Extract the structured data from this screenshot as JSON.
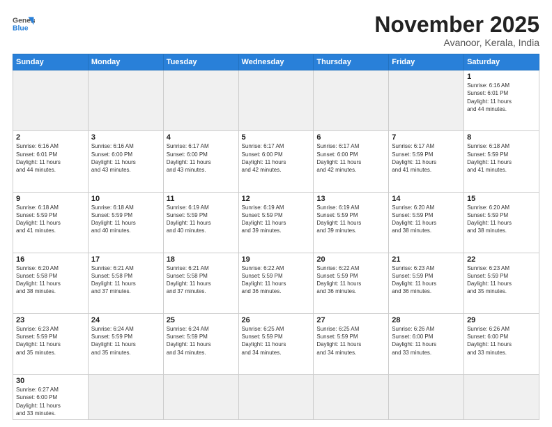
{
  "logo": {
    "line1": "General",
    "line2": "Blue"
  },
  "title": "November 2025",
  "subtitle": "Avanoor, Kerala, India",
  "days_header": [
    "Sunday",
    "Monday",
    "Tuesday",
    "Wednesday",
    "Thursday",
    "Friday",
    "Saturday"
  ],
  "weeks": [
    [
      {
        "day": "",
        "info": ""
      },
      {
        "day": "",
        "info": ""
      },
      {
        "day": "",
        "info": ""
      },
      {
        "day": "",
        "info": ""
      },
      {
        "day": "",
        "info": ""
      },
      {
        "day": "",
        "info": ""
      },
      {
        "day": "1",
        "info": "Sunrise: 6:16 AM\nSunset: 6:01 PM\nDaylight: 11 hours\nand 44 minutes."
      }
    ],
    [
      {
        "day": "2",
        "info": "Sunrise: 6:16 AM\nSunset: 6:01 PM\nDaylight: 11 hours\nand 44 minutes."
      },
      {
        "day": "3",
        "info": "Sunrise: 6:16 AM\nSunset: 6:00 PM\nDaylight: 11 hours\nand 43 minutes."
      },
      {
        "day": "4",
        "info": "Sunrise: 6:17 AM\nSunset: 6:00 PM\nDaylight: 11 hours\nand 43 minutes."
      },
      {
        "day": "5",
        "info": "Sunrise: 6:17 AM\nSunset: 6:00 PM\nDaylight: 11 hours\nand 42 minutes."
      },
      {
        "day": "6",
        "info": "Sunrise: 6:17 AM\nSunset: 6:00 PM\nDaylight: 11 hours\nand 42 minutes."
      },
      {
        "day": "7",
        "info": "Sunrise: 6:17 AM\nSunset: 5:59 PM\nDaylight: 11 hours\nand 41 minutes."
      },
      {
        "day": "8",
        "info": "Sunrise: 6:18 AM\nSunset: 5:59 PM\nDaylight: 11 hours\nand 41 minutes."
      }
    ],
    [
      {
        "day": "9",
        "info": "Sunrise: 6:18 AM\nSunset: 5:59 PM\nDaylight: 11 hours\nand 41 minutes."
      },
      {
        "day": "10",
        "info": "Sunrise: 6:18 AM\nSunset: 5:59 PM\nDaylight: 11 hours\nand 40 minutes."
      },
      {
        "day": "11",
        "info": "Sunrise: 6:19 AM\nSunset: 5:59 PM\nDaylight: 11 hours\nand 40 minutes."
      },
      {
        "day": "12",
        "info": "Sunrise: 6:19 AM\nSunset: 5:59 PM\nDaylight: 11 hours\nand 39 minutes."
      },
      {
        "day": "13",
        "info": "Sunrise: 6:19 AM\nSunset: 5:59 PM\nDaylight: 11 hours\nand 39 minutes."
      },
      {
        "day": "14",
        "info": "Sunrise: 6:20 AM\nSunset: 5:59 PM\nDaylight: 11 hours\nand 38 minutes."
      },
      {
        "day": "15",
        "info": "Sunrise: 6:20 AM\nSunset: 5:59 PM\nDaylight: 11 hours\nand 38 minutes."
      }
    ],
    [
      {
        "day": "16",
        "info": "Sunrise: 6:20 AM\nSunset: 5:58 PM\nDaylight: 11 hours\nand 38 minutes."
      },
      {
        "day": "17",
        "info": "Sunrise: 6:21 AM\nSunset: 5:58 PM\nDaylight: 11 hours\nand 37 minutes."
      },
      {
        "day": "18",
        "info": "Sunrise: 6:21 AM\nSunset: 5:58 PM\nDaylight: 11 hours\nand 37 minutes."
      },
      {
        "day": "19",
        "info": "Sunrise: 6:22 AM\nSunset: 5:59 PM\nDaylight: 11 hours\nand 36 minutes."
      },
      {
        "day": "20",
        "info": "Sunrise: 6:22 AM\nSunset: 5:59 PM\nDaylight: 11 hours\nand 36 minutes."
      },
      {
        "day": "21",
        "info": "Sunrise: 6:23 AM\nSunset: 5:59 PM\nDaylight: 11 hours\nand 36 minutes."
      },
      {
        "day": "22",
        "info": "Sunrise: 6:23 AM\nSunset: 5:59 PM\nDaylight: 11 hours\nand 35 minutes."
      }
    ],
    [
      {
        "day": "23",
        "info": "Sunrise: 6:23 AM\nSunset: 5:59 PM\nDaylight: 11 hours\nand 35 minutes."
      },
      {
        "day": "24",
        "info": "Sunrise: 6:24 AM\nSunset: 5:59 PM\nDaylight: 11 hours\nand 35 minutes."
      },
      {
        "day": "25",
        "info": "Sunrise: 6:24 AM\nSunset: 5:59 PM\nDaylight: 11 hours\nand 34 minutes."
      },
      {
        "day": "26",
        "info": "Sunrise: 6:25 AM\nSunset: 5:59 PM\nDaylight: 11 hours\nand 34 minutes."
      },
      {
        "day": "27",
        "info": "Sunrise: 6:25 AM\nSunset: 5:59 PM\nDaylight: 11 hours\nand 34 minutes."
      },
      {
        "day": "28",
        "info": "Sunrise: 6:26 AM\nSunset: 6:00 PM\nDaylight: 11 hours\nand 33 minutes."
      },
      {
        "day": "29",
        "info": "Sunrise: 6:26 AM\nSunset: 6:00 PM\nDaylight: 11 hours\nand 33 minutes."
      }
    ],
    [
      {
        "day": "30",
        "info": "Sunrise: 6:27 AM\nSunset: 6:00 PM\nDaylight: 11 hours\nand 33 minutes."
      },
      {
        "day": "",
        "info": ""
      },
      {
        "day": "",
        "info": ""
      },
      {
        "day": "",
        "info": ""
      },
      {
        "day": "",
        "info": ""
      },
      {
        "day": "",
        "info": ""
      },
      {
        "day": "",
        "info": ""
      }
    ]
  ]
}
